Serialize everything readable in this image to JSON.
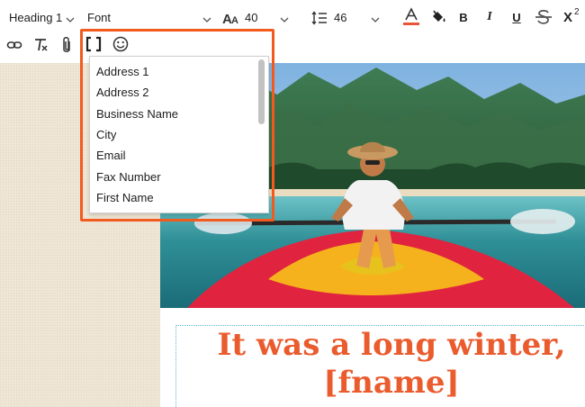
{
  "toolbar": {
    "heading_select": "Heading 1",
    "font_select": "Font",
    "font_size": "40",
    "line_height": "46",
    "superscript_label": "X",
    "superscript_exp": "2"
  },
  "merge_tags": {
    "items": [
      "Address 1",
      "Address 2",
      "Business Name",
      "City",
      "Email",
      "Fax Number",
      "First Name"
    ]
  },
  "content": {
    "headline_line1": "It was a long winter,",
    "headline_line2": "[fname]"
  },
  "colors": {
    "accent": "#f25a1e",
    "headline": "#ea5b2d",
    "text_color_underline": "#e8553b"
  }
}
